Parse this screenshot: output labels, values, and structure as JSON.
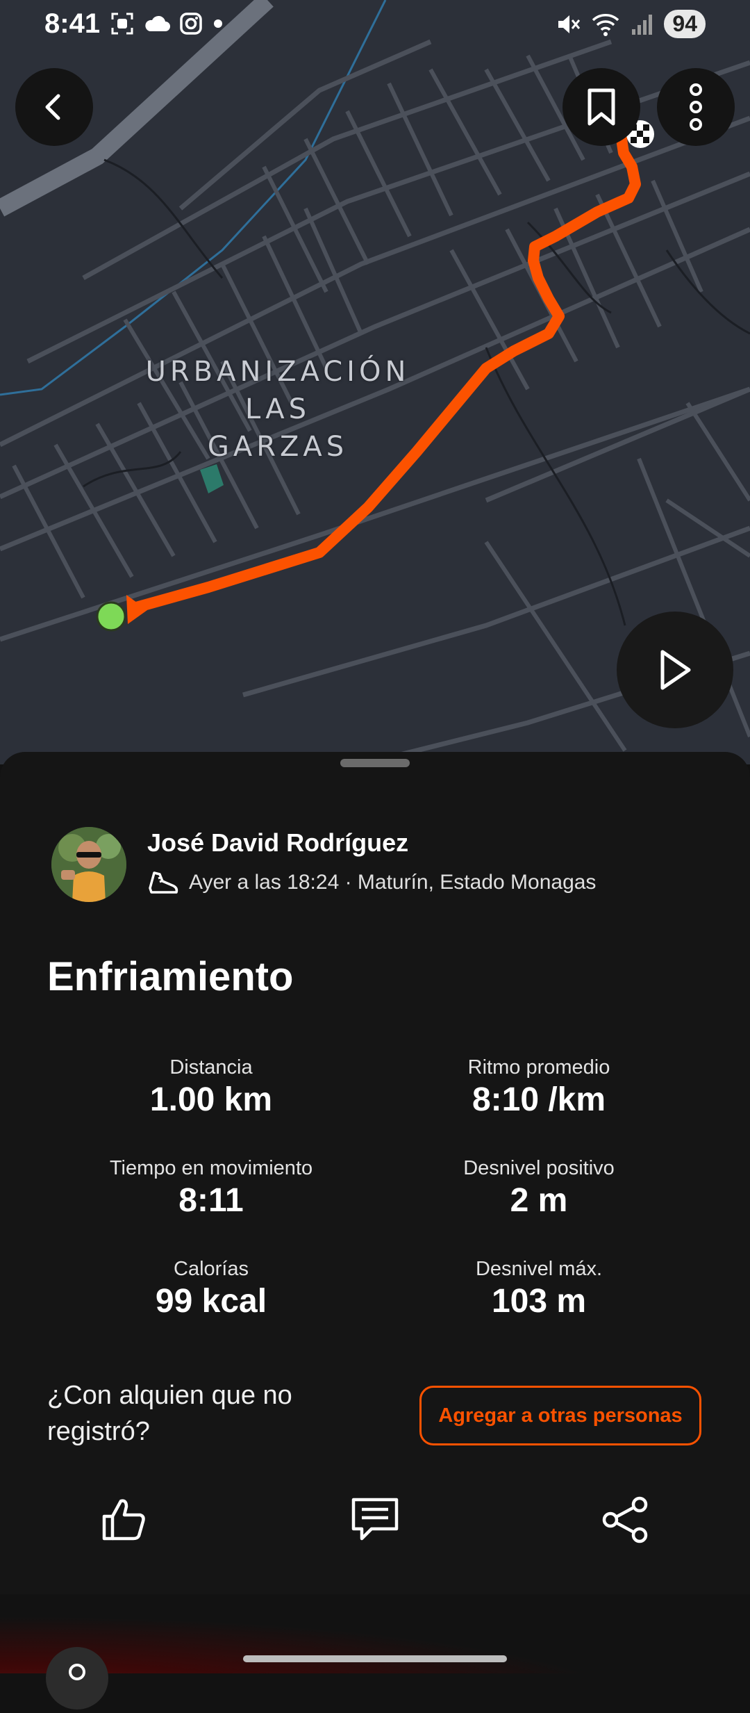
{
  "status_bar": {
    "time": "8:41",
    "battery": "94",
    "icons": [
      "screenshot-icon",
      "cloud-icon",
      "instagram-icon",
      "dot-icon",
      "mute-icon",
      "wifi-icon",
      "signal-icon"
    ]
  },
  "map": {
    "area_label_lines": [
      "URBANIZACIÓN",
      "LAS",
      "GARZAS"
    ],
    "route_color": "#fc5200",
    "start_marker_color": "#7ed957",
    "background_color": "#2c3039"
  },
  "map_controls": {
    "back": "back-arrow-icon",
    "bookmark": "bookmark-icon",
    "more": "more-vertical-icon",
    "play": "play-icon"
  },
  "activity": {
    "author": "José David Rodríguez",
    "meta": "Ayer a las 18:24 · Maturín, Estado Monagas",
    "sport_icon": "running-shoe-icon",
    "title": "Enfriamiento"
  },
  "stats": [
    {
      "label": "Distancia",
      "value": "1.00 km"
    },
    {
      "label": "Ritmo promedio",
      "value": "8:10 /km"
    },
    {
      "label": "Tiempo en movimiento",
      "value": "8:11"
    },
    {
      "label": "Desnivel positivo",
      "value": "2 m"
    },
    {
      "label": "Calorías",
      "value": "99 kcal"
    },
    {
      "label": "Desnivel máx.",
      "value": "103 m"
    }
  ],
  "with_others": {
    "question": "¿Con alquien que no registró?",
    "button": "Agregar a otras personas"
  },
  "actions": [
    "like-icon",
    "comment-icon",
    "share-icon"
  ],
  "accent_color": "#fc5200"
}
